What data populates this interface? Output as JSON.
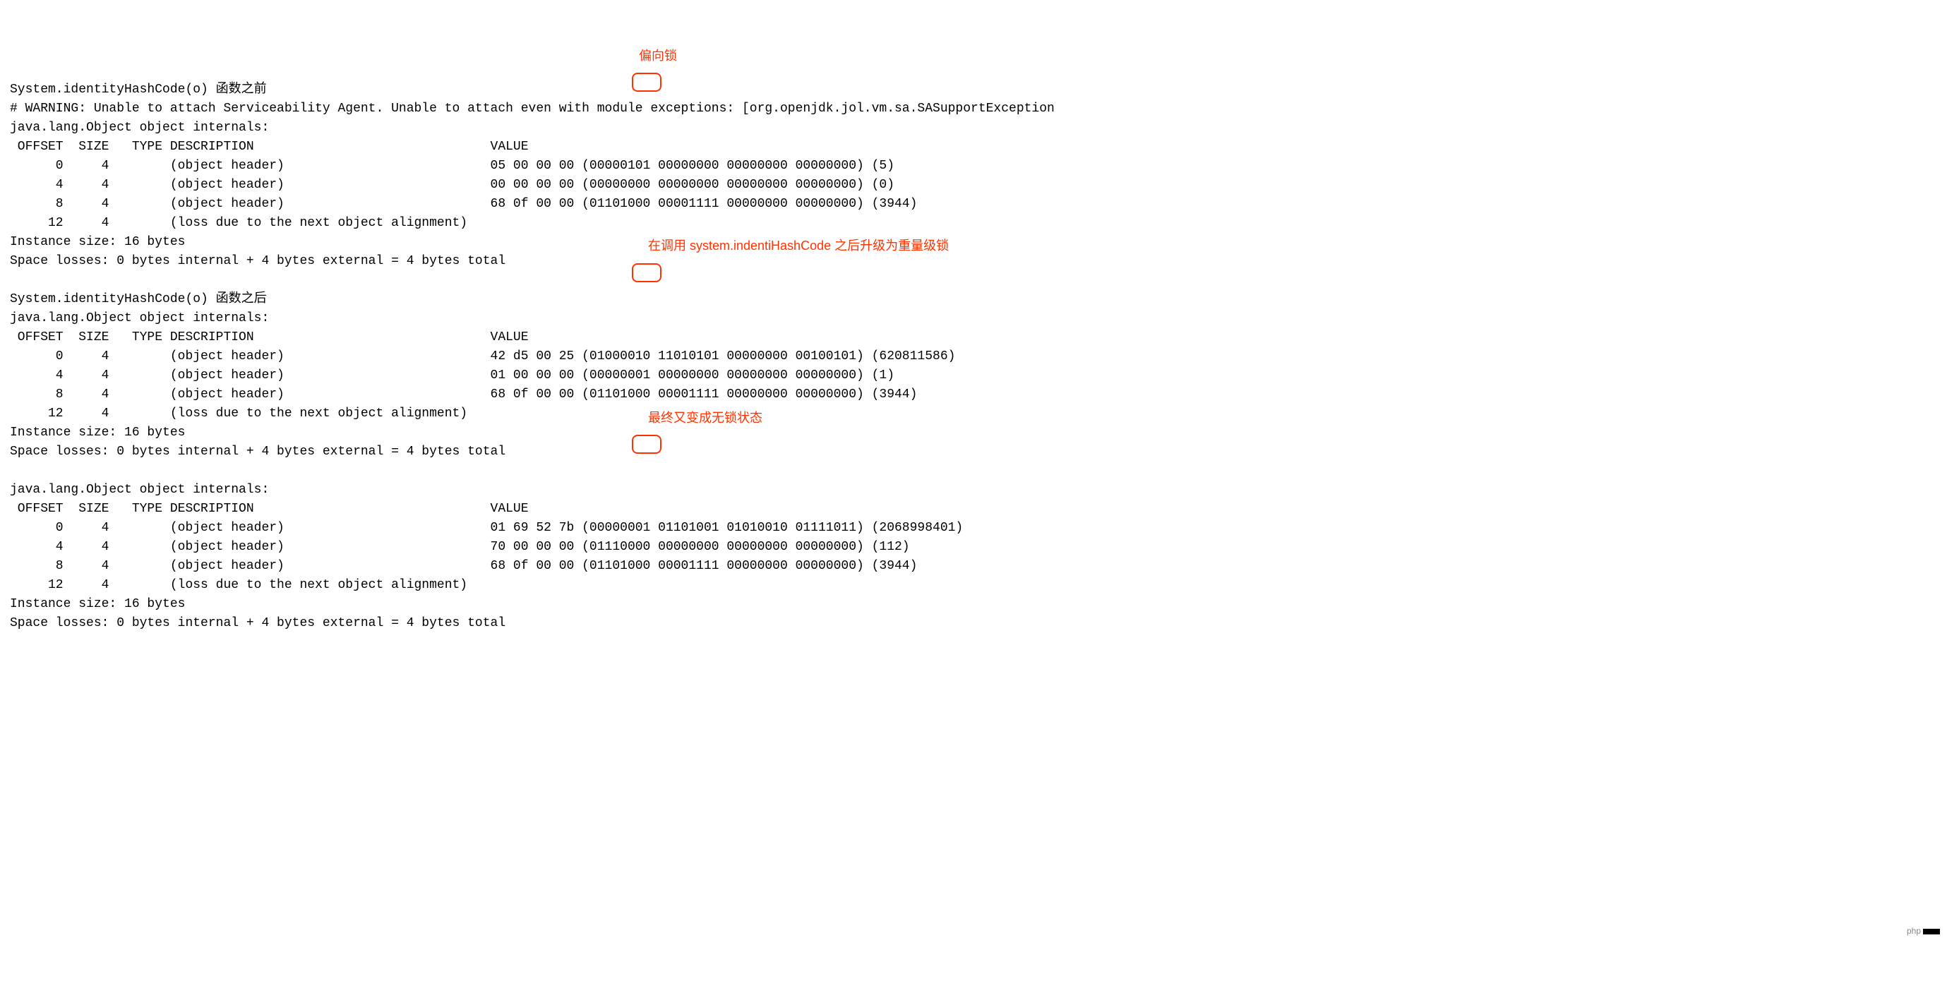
{
  "annotations": {
    "a1": "偏向锁",
    "a2": "在调用 system.indentiHashCode 之后升级为重量级锁",
    "a3": "最终又变成无锁状态"
  },
  "watermark": "php",
  "blocks": {
    "b1": {
      "title": "System.identityHashCode(o) 函数之前",
      "warning": "# WARNING: Unable to attach Serviceability Agent. Unable to attach even with module exceptions: [org.openjdk.jol.vm.sa.SASupportException",
      "intern": "java.lang.Object object internals:",
      "header": " OFFSET  SIZE   TYPE DESCRIPTION                               VALUE",
      "rows": [
        "      0     4        (object header)                           05 00 00 00 (00000101 00000000 00000000 00000000) (5)",
        "      4     4        (object header)                           00 00 00 00 (00000000 00000000 00000000 00000000) (0)",
        "      8     4        (object header)                           68 0f 00 00 (01101000 00001111 00000000 00000000) (3944)",
        "     12     4        (loss due to the next object alignment)"
      ],
      "size": "Instance size: 16 bytes",
      "loss": "Space losses: 0 bytes internal + 4 bytes external = 4 bytes total"
    },
    "b2": {
      "title": "System.identityHashCode(o) 函数之后",
      "intern": "java.lang.Object object internals:",
      "header": " OFFSET  SIZE   TYPE DESCRIPTION                               VALUE",
      "rows": [
        "      0     4        (object header)                           42 d5 00 25 (01000010 11010101 00000000 00100101) (620811586)",
        "      4     4        (object header)                           01 00 00 00 (00000001 00000000 00000000 00000000) (1)",
        "      8     4        (object header)                           68 0f 00 00 (01101000 00001111 00000000 00000000) (3944)",
        "     12     4        (loss due to the next object alignment)"
      ],
      "size": "Instance size: 16 bytes",
      "loss": "Space losses: 0 bytes internal + 4 bytes external = 4 bytes total"
    },
    "b3": {
      "intern": "java.lang.Object object internals:",
      "header": " OFFSET  SIZE   TYPE DESCRIPTION                               VALUE",
      "rows": [
        "      0     4        (object header)                           01 69 52 7b (00000001 01101001 01010010 01111011) (2068998401)",
        "      4     4        (object header)                           70 00 00 00 (01110000 00000000 00000000 00000000) (112)",
        "      8     4        (object header)                           68 0f 00 00 (01101000 00001111 00000000 00000000) (3944)",
        "     12     4        (loss due to the next object alignment)"
      ],
      "size": "Instance size: 16 bytes",
      "loss": "Space losses: 0 bytes internal + 4 bytes external = 4 bytes total"
    }
  }
}
